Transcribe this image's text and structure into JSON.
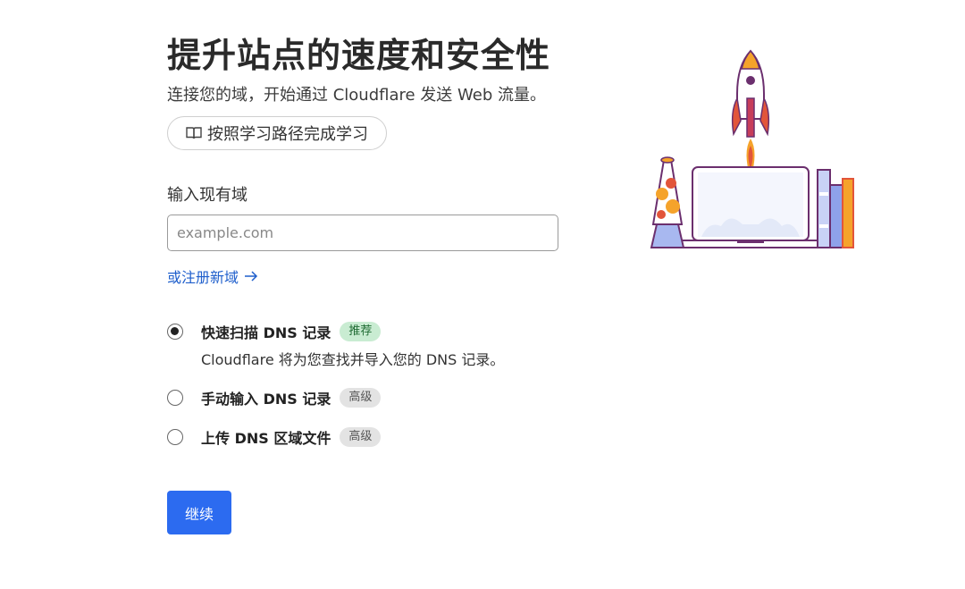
{
  "header": {
    "title": "提升站点的速度和安全性",
    "subtitle": "连接您的域，开始通过 Cloudflare 发送 Web 流量。",
    "learn_button_label": "按照学习路径完成学习"
  },
  "domain": {
    "label": "输入现有域",
    "placeholder": "example.com",
    "value": "",
    "register_link_label": "或注册新域"
  },
  "options": [
    {
      "title": "快速扫描 DNS 记录",
      "badge": "推荐",
      "description": "Cloudflare 将为您查找并导入您的 DNS 记录。",
      "selected": true
    },
    {
      "title": "手动输入 DNS 记录",
      "badge": "高级",
      "selected": false
    },
    {
      "title": "上传 DNS 区域文件",
      "badge": "高级",
      "selected": false
    }
  ],
  "actions": {
    "continue_label": "继续"
  },
  "icons": {
    "learn": "book-icon",
    "register": "arrow-right-icon",
    "illustration": "rocket-laptop-illustration"
  },
  "colors": {
    "primary": "#2c6bf0",
    "link": "#1f5fcc",
    "recommended_badge_bg": "#c9ecd2",
    "advanced_badge_bg": "#e3e3e3"
  }
}
